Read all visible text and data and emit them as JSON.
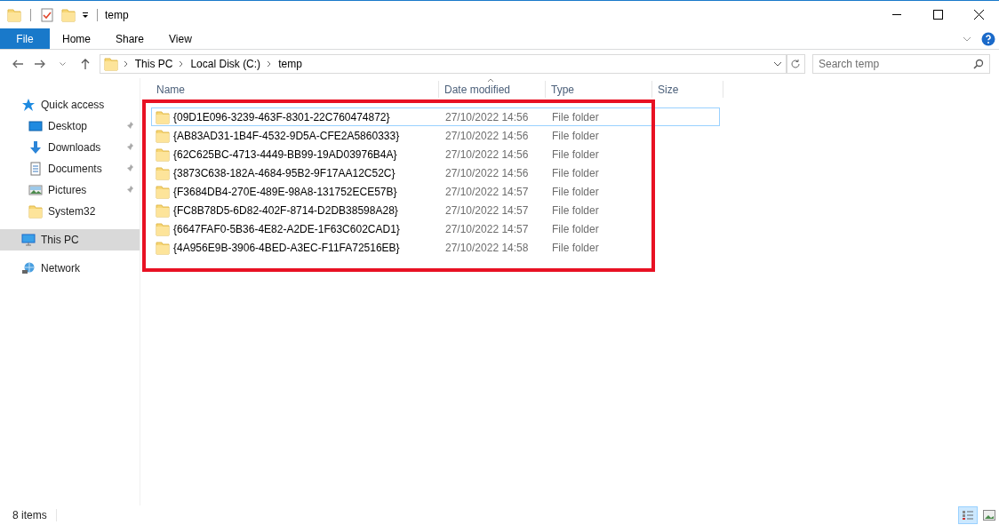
{
  "window": {
    "title": "temp"
  },
  "ribbon_tabs": [
    {
      "label": "File",
      "kind": "file",
      "selected": false
    },
    {
      "label": "Home",
      "kind": "tab",
      "selected": false
    },
    {
      "label": "Share",
      "kind": "tab",
      "selected": false
    },
    {
      "label": "View",
      "kind": "tab",
      "selected": false
    }
  ],
  "address_bar": {
    "breadcrumbs": [
      "This PC",
      "Local Disk (C:)",
      "temp"
    ]
  },
  "search": {
    "placeholder": "Search temp"
  },
  "sidebar": {
    "items": [
      {
        "label": "Quick access",
        "kind": "star",
        "selected": false,
        "pinned": false,
        "children": [
          {
            "label": "Desktop",
            "kind": "desktop",
            "selected": false,
            "pinned": true
          },
          {
            "label": "Downloads",
            "kind": "download",
            "selected": false,
            "pinned": true
          },
          {
            "label": "Documents",
            "kind": "document",
            "selected": false,
            "pinned": true
          },
          {
            "label": "Pictures",
            "kind": "pictures",
            "selected": false,
            "pinned": true
          },
          {
            "label": "System32",
            "kind": "folder",
            "selected": false,
            "pinned": false
          }
        ]
      },
      {
        "label": "This PC",
        "kind": "pc",
        "selected": true,
        "pinned": false
      },
      {
        "label": "Network",
        "kind": "network",
        "selected": false,
        "pinned": false
      }
    ]
  },
  "table": {
    "columns": [
      "Name",
      "Date modified",
      "Type",
      "Size"
    ],
    "rows": [
      {
        "name": "{09D1E096-3239-463F-8301-22C760474872}",
        "date": "27/10/2022 14:56",
        "type": "File folder",
        "focused": true
      },
      {
        "name": "{AB83AD31-1B4F-4532-9D5A-CFE2A5860333}",
        "date": "27/10/2022 14:56",
        "type": "File folder",
        "focused": false
      },
      {
        "name": "{62C625BC-4713-4449-BB99-19AD03976B4A}",
        "date": "27/10/2022 14:56",
        "type": "File folder",
        "focused": false
      },
      {
        "name": "{3873C638-182A-4684-95B2-9F17AA12C52C}",
        "date": "27/10/2022 14:56",
        "type": "File folder",
        "focused": false
      },
      {
        "name": "{F3684DB4-270E-489E-98A8-131752ECE57B}",
        "date": "27/10/2022 14:57",
        "type": "File folder",
        "focused": false
      },
      {
        "name": "{FC8B78D5-6D82-402F-8714-D2DB38598A28}",
        "date": "27/10/2022 14:57",
        "type": "File folder",
        "focused": false
      },
      {
        "name": "{6647FAF0-5B36-4E82-A2DE-1F63C602CAD1}",
        "date": "27/10/2022 14:57",
        "type": "File folder",
        "focused": false
      },
      {
        "name": "{4A956E9B-3906-4BED-A3EC-F11FA72516EB}",
        "date": "27/10/2022 14:58",
        "type": "File folder",
        "focused": false
      }
    ]
  },
  "highlight": {
    "kind": "rectangle"
  },
  "status_bar": {
    "item_count": "8 items"
  }
}
